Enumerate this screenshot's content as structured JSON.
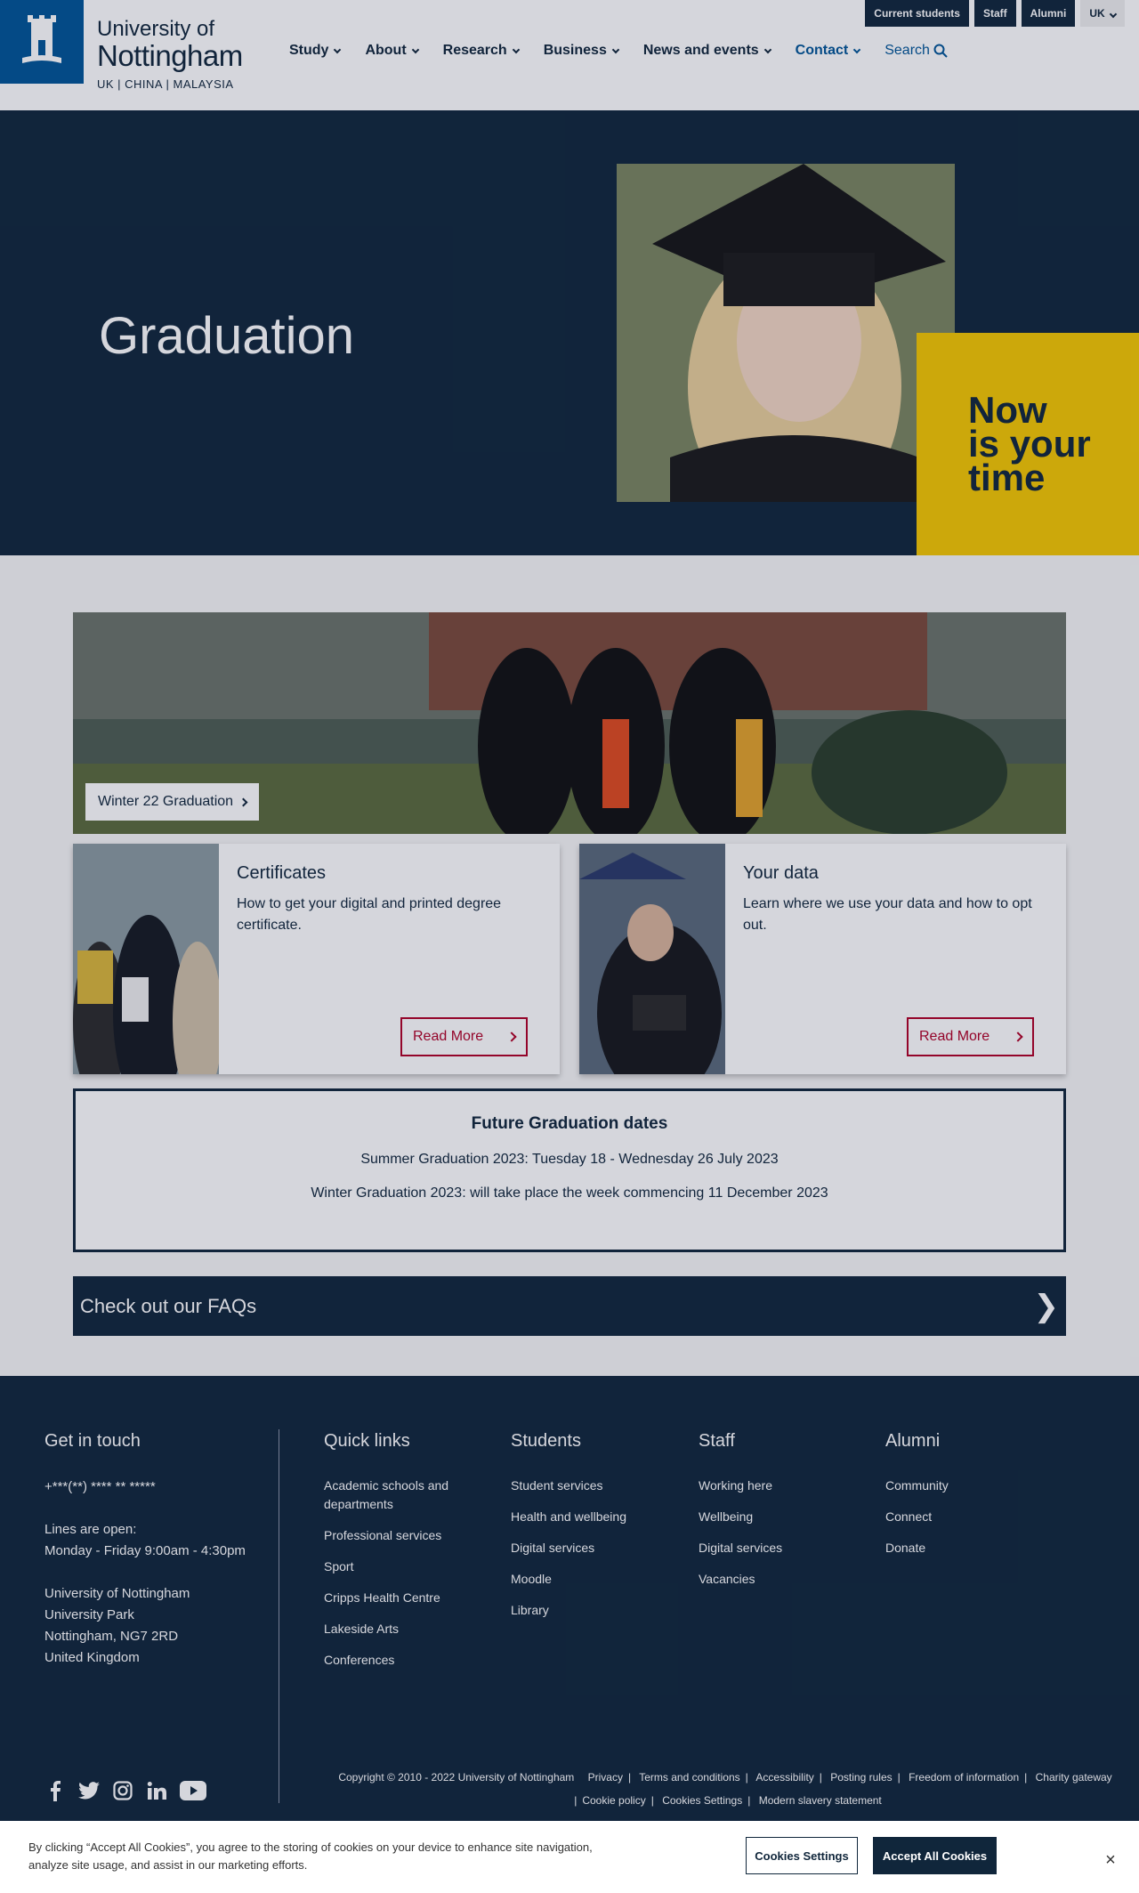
{
  "header": {
    "logo_line1": "University of",
    "logo_line2": "Nottingham",
    "logo_line3": "UK | CHINA | MALAYSIA",
    "utility": [
      "Current students",
      "Staff",
      "Alumni",
      "UK"
    ],
    "nav": [
      {
        "label": "Study"
      },
      {
        "label": "About"
      },
      {
        "label": "Research"
      },
      {
        "label": "Business"
      },
      {
        "label": "News and events"
      },
      {
        "label": "Contact"
      }
    ],
    "search_label": "Search"
  },
  "hero": {
    "title": "Graduation",
    "tagline": "Now\nis your\ntime"
  },
  "banner": {
    "label": "Winter 22 Graduation"
  },
  "cards": [
    {
      "title": "Certificates",
      "text": "How to get your digital and printed degree certificate.",
      "button": "Read More"
    },
    {
      "title": "Your data",
      "text": "Learn where we use your data and how to opt out.",
      "button": "Read More"
    }
  ],
  "future": {
    "title": "Future Graduation dates",
    "line1": "Summer Graduation 2023: Tuesday 18 - Wednesday 26 July 2023",
    "line2": "Winter Graduation 2023: will take place the week commencing 11 December 2023"
  },
  "faq": {
    "label": "Check out our FAQs",
    "arrow": "❯"
  },
  "footer": {
    "contact": {
      "title": "Get in touch",
      "phone": "+***(**) **** ** *****",
      "lines_title": "Lines are open:",
      "lines_hours": "Monday - Friday 9:00am - 4:30pm",
      "address": [
        "University of Nottingham",
        "University Park",
        "Nottingham, NG7 2RD",
        "United Kingdom"
      ]
    },
    "quick_links": {
      "title": "Quick links",
      "items": [
        "Academic schools and departments",
        "Professional services",
        "Sport",
        "Cripps Health Centre",
        "Lakeside Arts",
        "Conferences"
      ]
    },
    "students": {
      "title": "Students",
      "items": [
        "Student services",
        "Health and wellbeing",
        "Digital services",
        "Moodle",
        "Library"
      ]
    },
    "staff": {
      "title": "Staff",
      "items": [
        "Working here",
        "Wellbeing",
        "Digital services",
        "Vacancies"
      ]
    },
    "alumni": {
      "title": "Alumni",
      "items": [
        "Community",
        "Connect",
        "Donate"
      ]
    },
    "legal": [
      "Copyright © 2010 - 2022 University of Nottingham",
      "Privacy",
      "Terms and conditions",
      "Accessibility",
      "Posting rules",
      "Freedom of information",
      "Charity gateway",
      "Cookie policy",
      "Cookies Settings",
      "Modern slavery statement"
    ]
  },
  "cookie": {
    "text": "By clicking “Accept All Cookies”, you agree to the storing of cookies on your device to enhance site navigation, analyze site usage, and assist in our marketing efforts.",
    "settings": "Cookies Settings",
    "accept": "Accept All Cookies",
    "close": "×"
  },
  "colors": {
    "navy": "#10263b",
    "blue": "#005597",
    "yellow": "#f5c700",
    "red": "#b00026"
  }
}
